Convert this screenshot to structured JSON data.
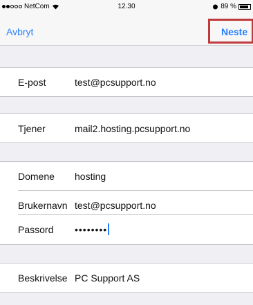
{
  "status_bar": {
    "carrier": "NetCom",
    "time": "12.30",
    "battery_percent": "89 %",
    "battery_level": 0.89
  },
  "nav": {
    "cancel_label": "Avbryt",
    "next_label": "Neste",
    "accent_color": "#2a7fff",
    "highlight_color": "#c0393b"
  },
  "form": {
    "email": {
      "label": "E-post",
      "value": "test@pcsupport.no"
    },
    "server": {
      "label": "Tjener",
      "value": "mail2.hosting.pcsupport.no"
    },
    "domain": {
      "label": "Domene",
      "value": "hosting"
    },
    "username": {
      "label": "Brukernavn",
      "value": "test@pcsupport.no"
    },
    "password": {
      "label": "Passord",
      "value": "••••••••"
    },
    "description": {
      "label": "Beskrivelse",
      "value": "PC Support AS"
    }
  }
}
